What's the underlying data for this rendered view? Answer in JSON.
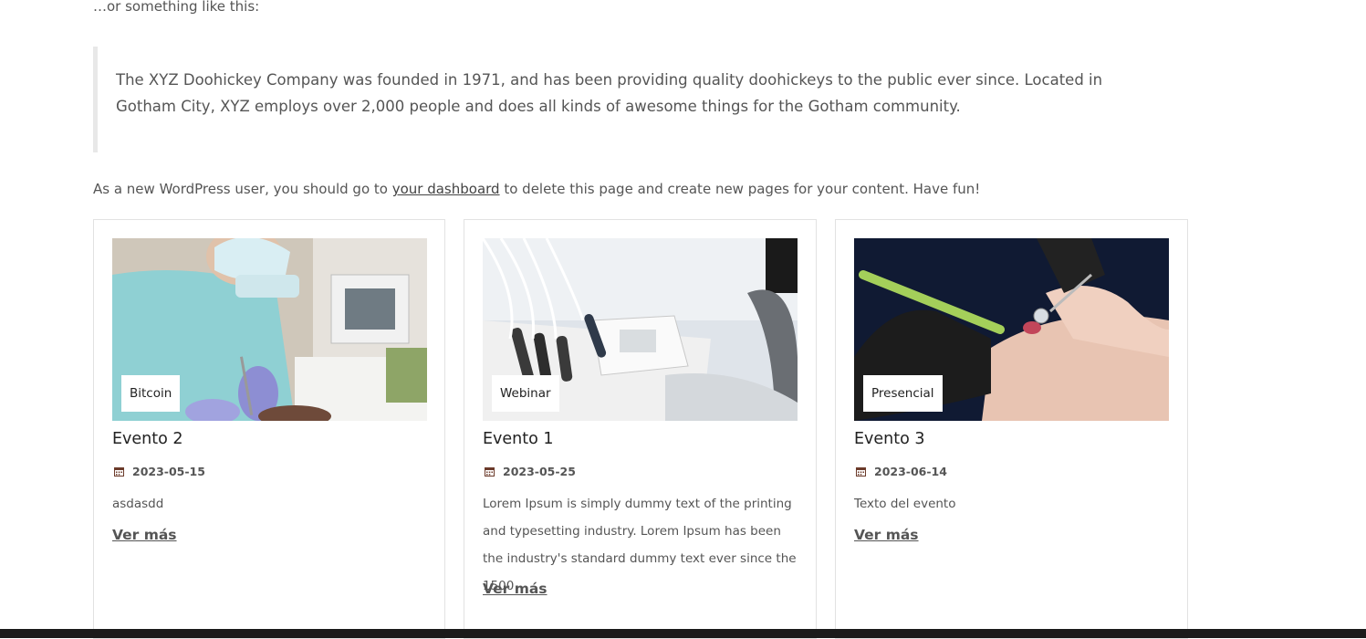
{
  "content": {
    "intro": "…or something like this:",
    "quote": "The XYZ Doohickey Company was founded in 1971, and has been providing quality doohickeys to the public ever since. Located in Gotham City, XYZ employs over 2,000 people and does all kinds of awesome things for the Gotham community.",
    "note_before": "As a new WordPress user, you should go to ",
    "note_link": "your dashboard",
    "note_after": " to delete this page and create new pages for your content. Have fun!"
  },
  "events": [
    {
      "badge": "Bitcoin",
      "title": "Evento 2",
      "date": "2023-05-15",
      "description": "asdasdd",
      "more": "Ver más"
    },
    {
      "badge": "Webinar",
      "title": "Evento 1",
      "date": "2023-05-25",
      "description": "Lorem Ipsum is simply dummy text of the printing and typesetting industry. Lorem Ipsum has been the industry's standard dummy text ever since the 1500",
      "more": "Ver más"
    },
    {
      "badge": "Presencial",
      "title": "Evento 3",
      "date": "2023-06-14",
      "description": "Texto del evento",
      "more": "Ver más"
    }
  ],
  "icons": {
    "date": "calendar-icon"
  }
}
